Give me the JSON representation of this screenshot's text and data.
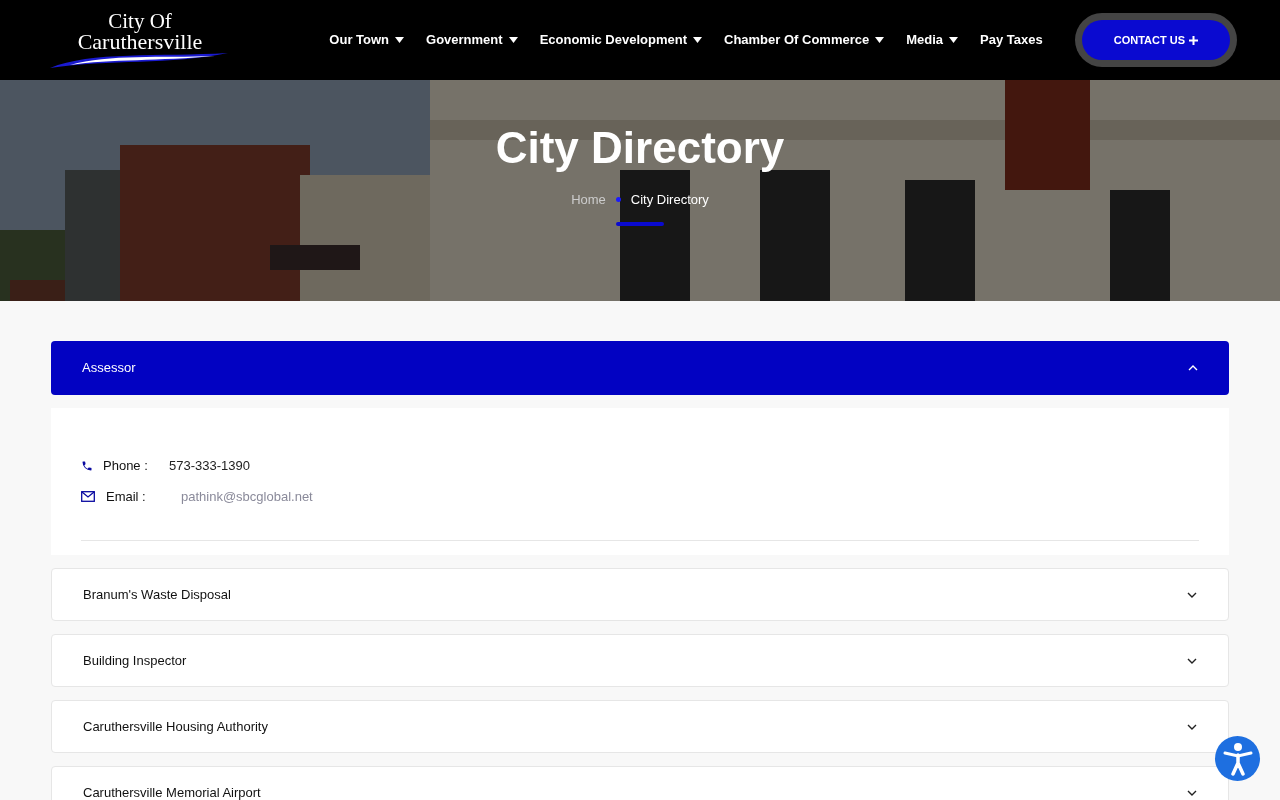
{
  "logo": {
    "line_1": "City Of",
    "line_2": "Caruthersville"
  },
  "nav": [
    {
      "label": "Our Town",
      "has_menu": true
    },
    {
      "label": "Government",
      "has_menu": true
    },
    {
      "label": "Economic Development",
      "has_menu": true
    },
    {
      "label": "Chamber Of Commerce",
      "has_menu": true
    },
    {
      "label": "Media",
      "has_menu": true
    },
    {
      "label": "Pay Taxes",
      "has_menu": false
    }
  ],
  "contact_button": {
    "label": "CONTACT US"
  },
  "hero": {
    "title": "City Directory",
    "breadcrumb": [
      {
        "label": "Home"
      },
      {
        "label": "City Directory"
      }
    ]
  },
  "directory": [
    {
      "name": "Assessor",
      "expanded": true,
      "details": [
        {
          "kind": "phone",
          "label": "Phone :",
          "value": "573-333-1390"
        },
        {
          "kind": "email",
          "label": "Email :",
          "value": "pathink@sbcglobal.net"
        }
      ]
    },
    {
      "name": "Branum's Waste Disposal",
      "expanded": false
    },
    {
      "name": "Building Inspector",
      "expanded": false
    },
    {
      "name": "Caruthersville Housing Authority",
      "expanded": false
    },
    {
      "name": "Caruthersville Memorial Airport",
      "expanded": false
    }
  ]
}
